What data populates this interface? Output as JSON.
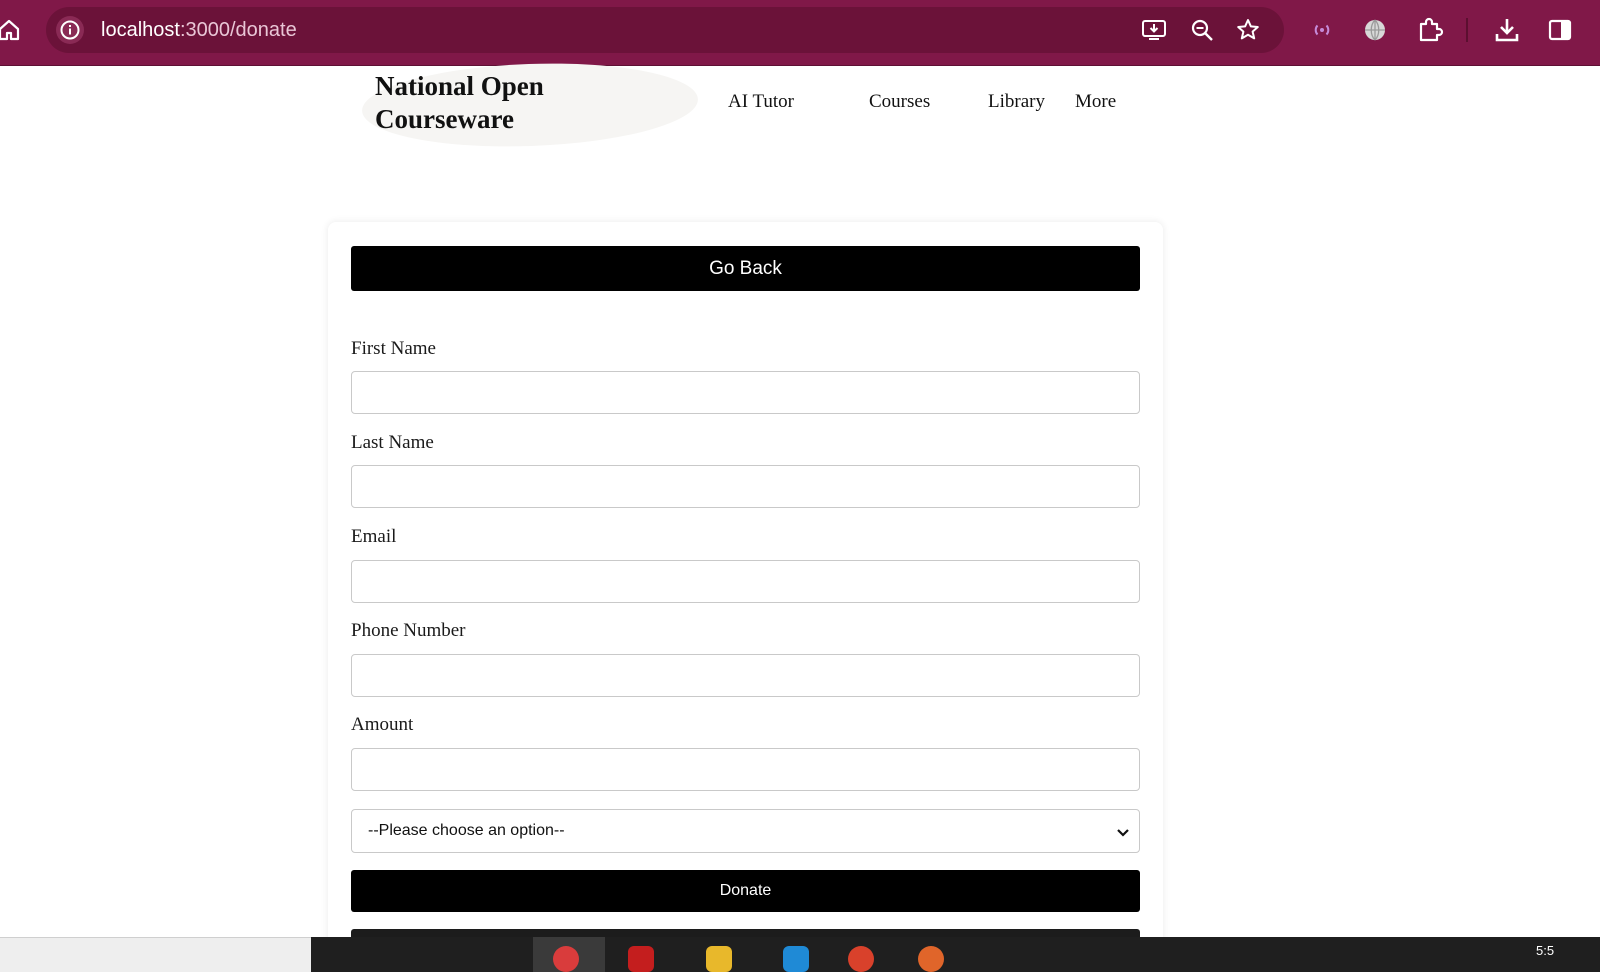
{
  "browser": {
    "url_host": "localhost",
    "url_path": ":3000/donate",
    "icons": [
      "home-icon",
      "site-info-icon",
      "install-app-icon",
      "zoom-icon",
      "bookmark-star-icon",
      "cast-icon",
      "translate-globe-icon",
      "extensions-icon",
      "download-icon",
      "side-panel-icon"
    ]
  },
  "site": {
    "logo": "National Open Courseware",
    "nav": {
      "ai_tutor": "AI Tutor",
      "courses": "Courses",
      "library": "Library",
      "more": "More"
    }
  },
  "form": {
    "go_back_label": "Go Back",
    "first_name": {
      "label": "First Name",
      "value": ""
    },
    "last_name": {
      "label": "Last Name",
      "value": ""
    },
    "email": {
      "label": "Email",
      "value": ""
    },
    "phone": {
      "label": "Phone Number",
      "value": ""
    },
    "amount": {
      "label": "Amount",
      "value": ""
    },
    "option_select": {
      "selected": "--Please choose an option--"
    },
    "donate_label": "Donate"
  },
  "taskbar": {
    "clock": "5:5"
  },
  "colors": {
    "browser_bar": "#801848",
    "omnibox": "#6b1239",
    "button": "#000000",
    "button_text": "#ffffff"
  }
}
